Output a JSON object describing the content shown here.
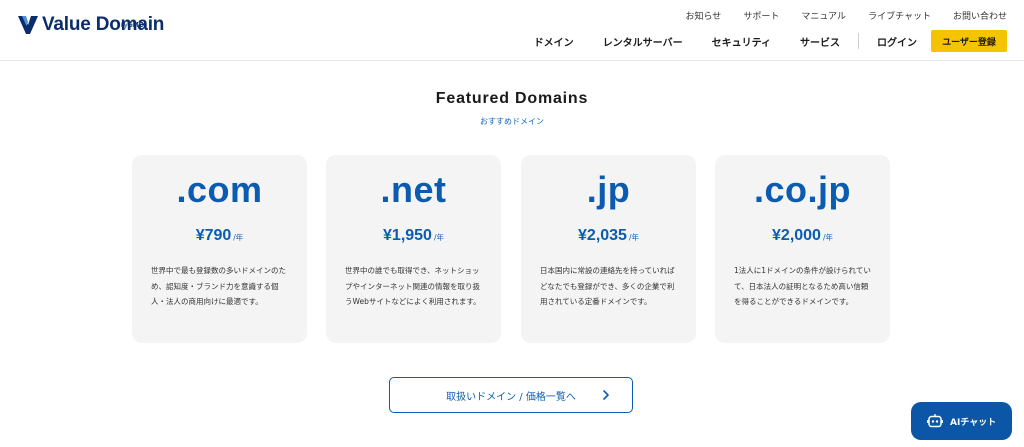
{
  "brand": {
    "name": "Value Domain",
    "byline_prefix": "by",
    "byline_brand": "GMO",
    "color": "#0b2d6b"
  },
  "util_nav": [
    "お知らせ",
    "サポート",
    "マニュアル",
    "ライブチャット",
    "お問い合わせ"
  ],
  "main_nav": {
    "items": [
      "ドメイン",
      "レンタルサーバー",
      "セキュリティ",
      "サービス"
    ],
    "login": "ログイン",
    "register": "ユーザー登録",
    "register_color": "#f5c400"
  },
  "section": {
    "title": "Featured Domains",
    "subtitle": "おすすめドメイン"
  },
  "cards": [
    {
      "tld": ".com",
      "price": "¥790",
      "unit": "/年",
      "desc": "世界中で最も登録数の多いドメインのため、認知度・ブランド力を意識する個人・法人の商用向けに最適です。"
    },
    {
      "tld": ".net",
      "price": "¥1,950",
      "unit": "/年",
      "desc": "世界中の誰でも取得でき、ネットショップやインターネット関連の情報を取り扱うWebサイトなどによく利用されます。"
    },
    {
      "tld": ".jp",
      "price": "¥2,035",
      "unit": "/年",
      "desc": "日本国内に常設の連絡先を持っていればどなたでも登録ができ、多くの企業で利用されている定番ドメインです。"
    },
    {
      "tld": ".co.jp",
      "price": "¥2,000",
      "unit": "/年",
      "desc": "1法人に1ドメインの条件が設けられていて、日本法人の証明となるため高い信頼を得ることができるドメインです。"
    }
  ],
  "cta": {
    "label": "取扱いドメイン / 価格一覧へ",
    "icon": "chevron-right-icon"
  },
  "ai_chat": {
    "label": "AIチャット",
    "icon": "robot-icon",
    "color": "#0b56a6"
  },
  "accent_color": "#0b5cb0"
}
